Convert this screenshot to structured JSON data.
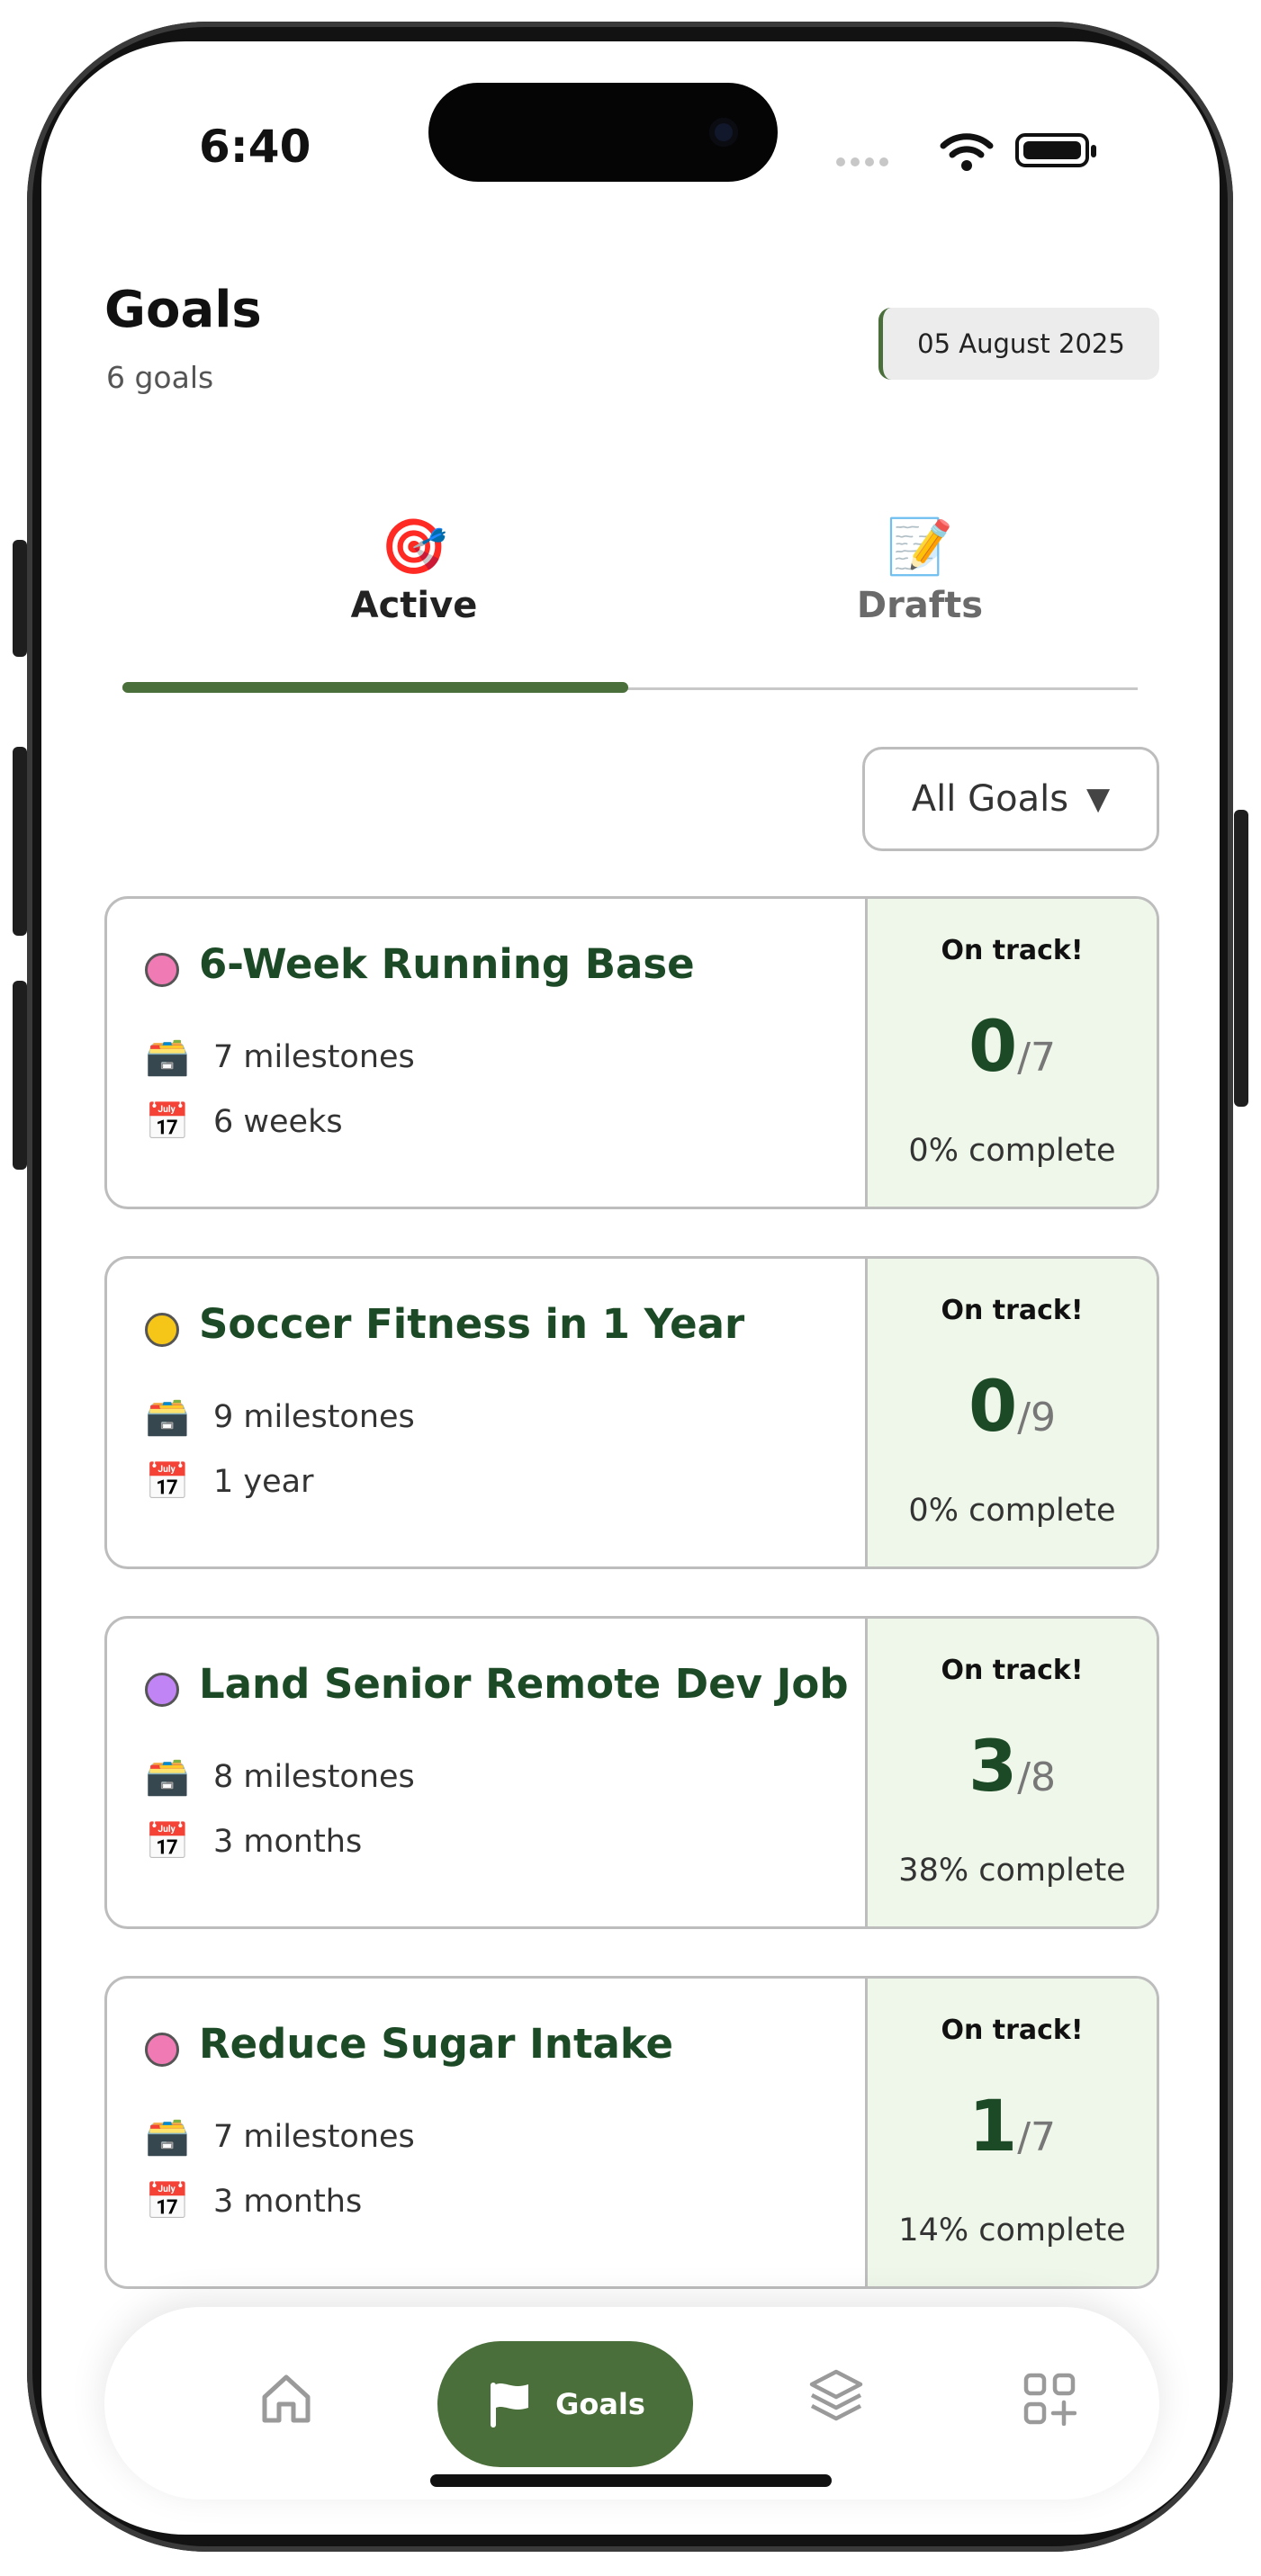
{
  "status_bar": {
    "time": "6:40"
  },
  "header": {
    "title": "Goals",
    "subtitle": "6 goals",
    "date": "05 August 2025"
  },
  "tabs": [
    {
      "icon": "🎯",
      "icon_name": "target-icon",
      "label": "Active",
      "active": true
    },
    {
      "icon": "📝",
      "icon_name": "memo-icon",
      "label": "Drafts",
      "active": false
    }
  ],
  "filter": {
    "label": "All Goals",
    "caret": "▼"
  },
  "goals": [
    {
      "name": "6-Week Running Base",
      "dot_color": "#f07bb4",
      "milestones": "7 milestones",
      "duration": "6 weeks",
      "status": "On track!",
      "done": "0",
      "total": "/7",
      "percent": "0% complete"
    },
    {
      "name": "Soccer Fitness in 1 Year",
      "dot_color": "#f5c518",
      "milestones": "9 milestones",
      "duration": "1 year",
      "status": "On track!",
      "done": "0",
      "total": "/9",
      "percent": "0% complete"
    },
    {
      "name": "Land Senior Remote Dev Job",
      "dot_color": "#c084f5",
      "milestones": "8 milestones",
      "duration": "3 months",
      "status": "On track!",
      "done": "3",
      "total": "/8",
      "percent": "38% complete"
    },
    {
      "name": "Reduce Sugar Intake",
      "dot_color": "#f07bb4",
      "milestones": "7 milestones",
      "duration": "3 months",
      "status": "On track!",
      "done": "1",
      "total": "/7",
      "percent": "14% complete"
    }
  ],
  "row_icons": {
    "milestones": "🗃️",
    "duration": "📅"
  },
  "bottom_nav": {
    "goals_label": "Goals"
  },
  "colors": {
    "accent": "#4a6f3a",
    "title_green": "#1d4a26",
    "status_bg": "#eef7e9"
  }
}
